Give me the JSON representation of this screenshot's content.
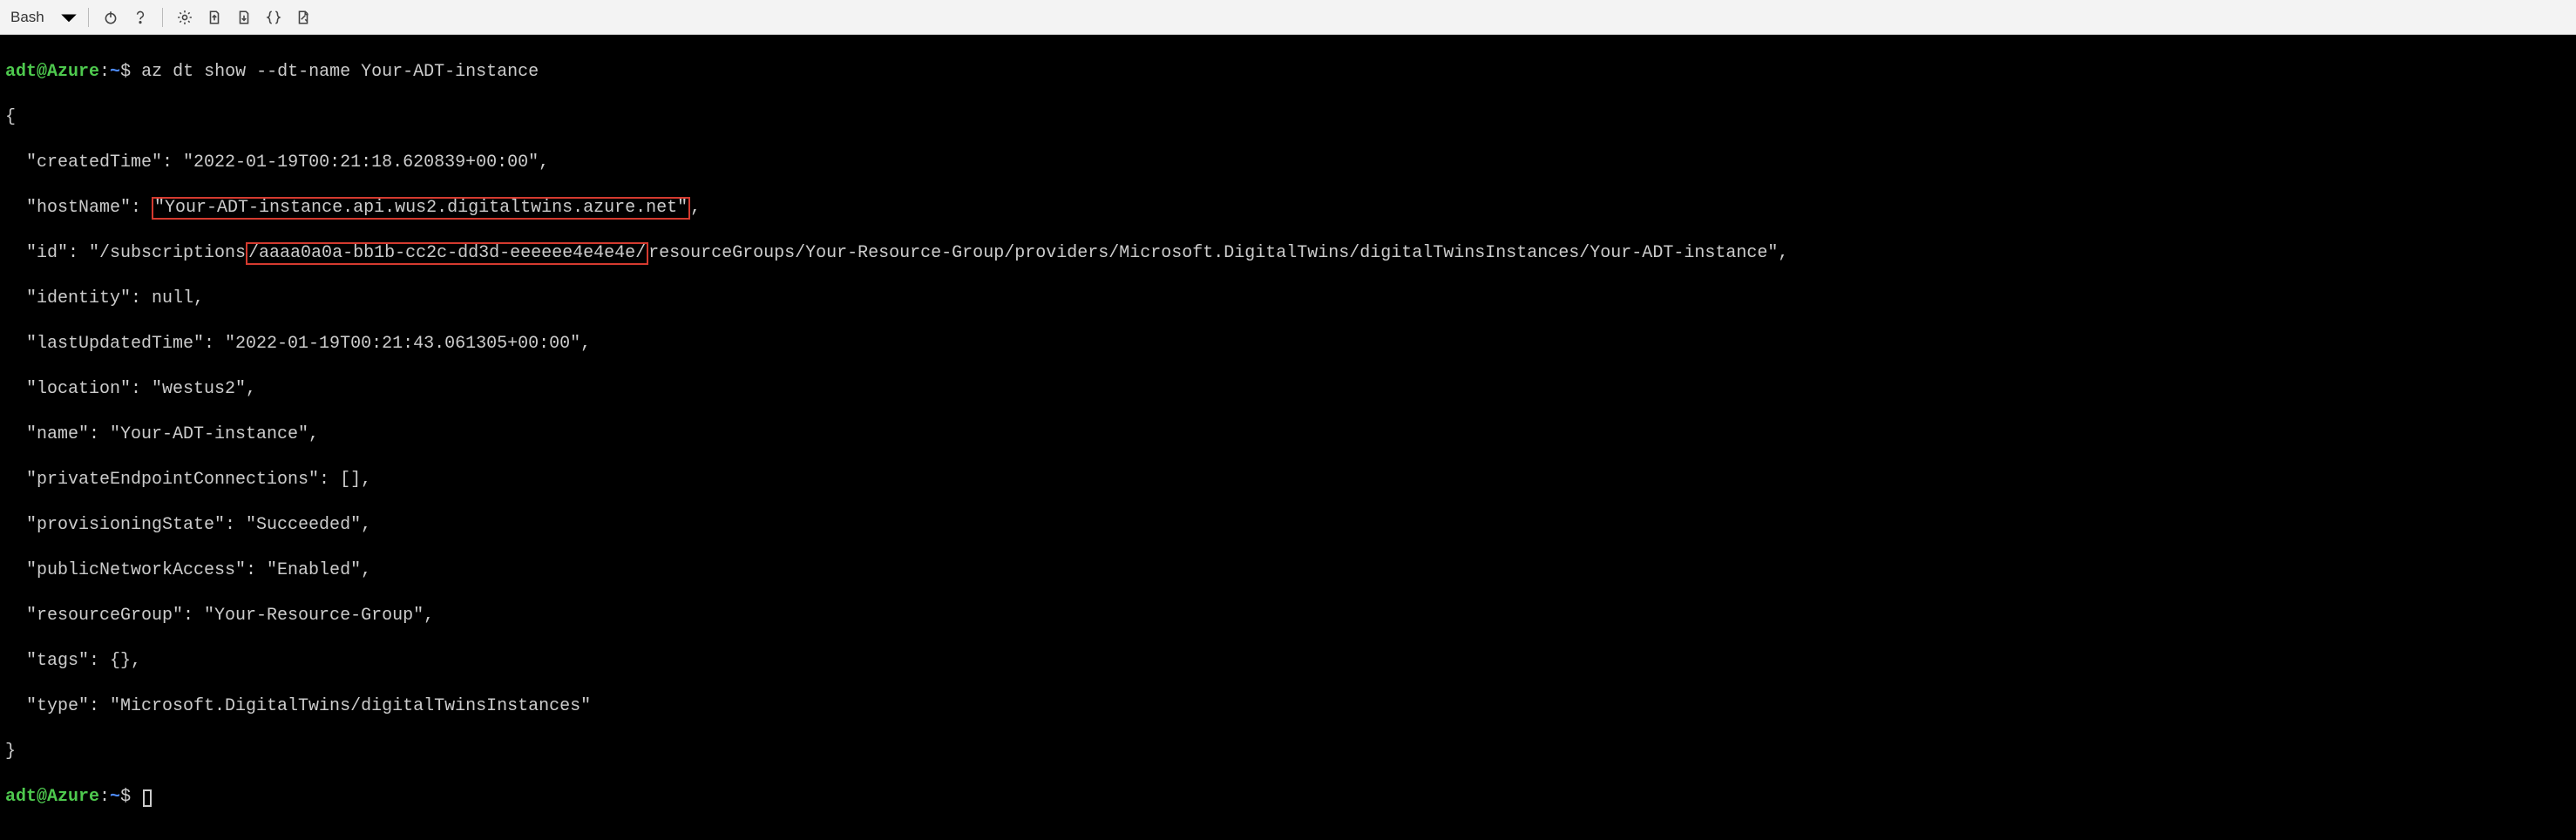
{
  "toolbar": {
    "shell_label": "Bash"
  },
  "prompt": {
    "user_host": "adt@Azure",
    "sep": ":",
    "path": "~",
    "dollar": "$"
  },
  "command": "az dt show --dt-name Your-ADT-instance",
  "output": {
    "open_brace": "{",
    "createdTime_label": "  \"createdTime\": ",
    "createdTime_value": "\"2022-01-19T00:21:18.620839+00:00\",",
    "hostName_label": "  \"hostName\": ",
    "hostName_hl": "\"Your-ADT-instance.api.wus2.digitaltwins.azure.net\"",
    "hostName_after": ",",
    "id_label": "  \"id\": \"/subscriptions",
    "id_hl": "/aaaa0a0a-bb1b-cc2c-dd3d-eeeeee4e4e4e/",
    "id_after": "resourceGroups/Your-Resource-Group/providers/Microsoft.DigitalTwins/digitalTwinsInstances/Your-ADT-instance\",",
    "identity_line": "  \"identity\": null,",
    "lastUpdated_line": "  \"lastUpdatedTime\": \"2022-01-19T00:21:43.061305+00:00\",",
    "location_line": "  \"location\": \"westus2\",",
    "name_line": "  \"name\": \"Your-ADT-instance\",",
    "pec_line": "  \"privateEndpointConnections\": [],",
    "prov_line": "  \"provisioningState\": \"Succeeded\",",
    "pna_line": "  \"publicNetworkAccess\": \"Enabled\",",
    "rg_line": "  \"resourceGroup\": \"Your-Resource-Group\",",
    "tags_line": "  \"tags\": {},",
    "type_line": "  \"type\": \"Microsoft.DigitalTwins/digitalTwinsInstances\"",
    "close_brace": "}"
  }
}
